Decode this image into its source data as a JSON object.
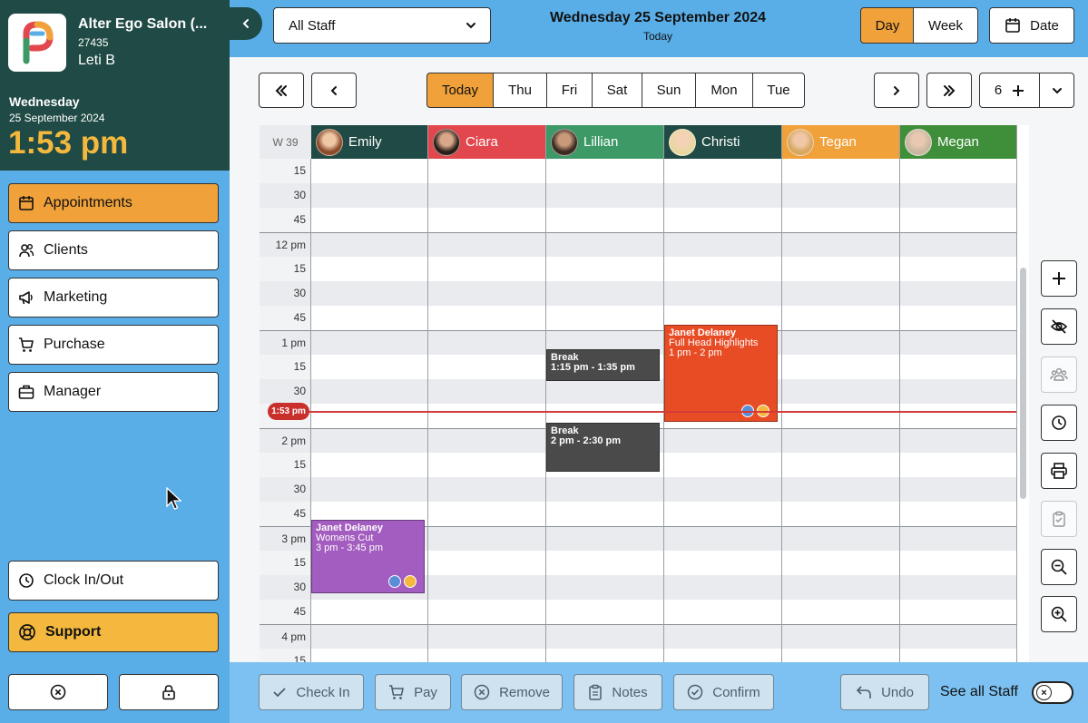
{
  "sidebar": {
    "salon_name": "Alter Ego Salon (...",
    "salon_id": "27435",
    "user": "Leti B",
    "day": "Wednesday",
    "date": "25 September 2024",
    "time": "1:53 pm",
    "nav": [
      {
        "label": "Appointments",
        "icon": "calendar-icon",
        "active": true
      },
      {
        "label": "Clients",
        "icon": "users-icon"
      },
      {
        "label": "Marketing",
        "icon": "megaphone-icon"
      },
      {
        "label": "Purchase",
        "icon": "cart-icon"
      },
      {
        "label": "Manager",
        "icon": "briefcase-icon"
      }
    ],
    "clock_label": "Clock In/Out",
    "support_label": "Support"
  },
  "topbar": {
    "staff_filter": "All Staff",
    "title": "Wednesday 25 September 2024",
    "subtitle": "Today",
    "view_day": "Day",
    "view_week": "Week",
    "date_btn": "Date"
  },
  "daynav": {
    "tabs": [
      "Today",
      "Thu",
      "Fri",
      "Sat",
      "Sun",
      "Mon",
      "Tue"
    ],
    "days_count": "6"
  },
  "calendar": {
    "week_label": "W 39",
    "staff": [
      {
        "name": "Emily",
        "color": "#1f4a45"
      },
      {
        "name": "Ciara",
        "color": "#e2474d"
      },
      {
        "name": "Lillian",
        "color": "#3d9a66"
      },
      {
        "name": "Christi",
        "color": "#1f4a45"
      },
      {
        "name": "Tegan",
        "color": "#f0a13a"
      },
      {
        "name": "Megan",
        "color": "#3f8f3a"
      }
    ],
    "time_labels": [
      "15",
      "30",
      "45",
      "12 pm",
      "15",
      "30",
      "45",
      "1 pm",
      "15",
      "30",
      "",
      "2 pm",
      "15",
      "30",
      "45",
      "3 pm",
      "15",
      "30",
      "45",
      "4 pm",
      "15"
    ],
    "now_label": "1:53 pm",
    "appointments": [
      {
        "staff": "Lillian",
        "title": "Break",
        "time": "1:15 pm - 1:35 pm",
        "color": "#4a4a4a"
      },
      {
        "staff": "Lillian",
        "title": "Break",
        "time": "2 pm - 2:30 pm",
        "color": "#4a4a4a"
      },
      {
        "staff": "Christi",
        "title": "Janet Delaney",
        "service": "Full Head Highlights",
        "time": "1 pm - 2 pm",
        "color": "#e84c25"
      },
      {
        "staff": "Emily",
        "title": "Janet Delaney",
        "service": "Womens Cut",
        "time": "3 pm - 3:45 pm",
        "color": "#a35cbf"
      }
    ]
  },
  "actions": {
    "check_in": "Check In",
    "pay": "Pay",
    "remove": "Remove",
    "notes": "Notes",
    "confirm": "Confirm",
    "undo": "Undo",
    "see_all": "See all Staff"
  }
}
